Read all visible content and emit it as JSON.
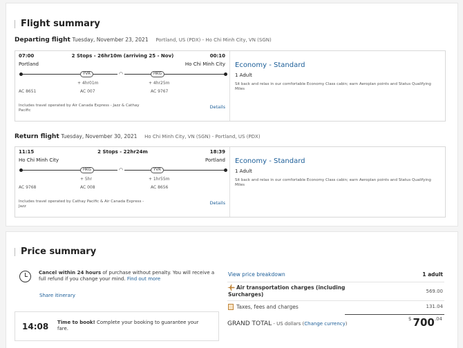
{
  "flight_summary": {
    "title": "Flight summary",
    "departing": {
      "label": "Departing flight",
      "date": "Tuesday, November 23, 2021",
      "route": "Portland, US (PDX) - Ho Chi Minh City, VN (SGN)",
      "dep_time": "07:00",
      "stops": "2 Stops - 26hr10m (arriving 25 - Nov)",
      "arr_time": "00:10",
      "origin": "Portland",
      "destination": "Ho Chi Minh City",
      "stop1": "YVR",
      "stop2": "HKG",
      "layover1": "+ 4hr01m",
      "layover2": "+ 4hr25m",
      "flight1": "AC 8651",
      "flight2": "AC 007",
      "flight3": "AC 9767",
      "operated_by": "Includes travel operated by Air Canada Express - Jazz & Cathay Pacific",
      "details": "Details",
      "cabin": "Economy - Standard",
      "passengers": "1 Adult",
      "cabin_desc": "Sit back and relax in our comfortable Economy Class cabin; earn Aeroplan points and Status Qualifying Miles"
    },
    "return": {
      "label": "Return flight",
      "date": "Tuesday, November 30, 2021",
      "route": "Ho Chi Minh City, VN (SGN) - Portland, US (PDX)",
      "dep_time": "11:15",
      "stops": "2 Stops - 22hr24m",
      "arr_time": "18:39",
      "origin": "Ho Chi Minh City",
      "destination": "Portland",
      "stop1": "HKG",
      "stop2": "YVR",
      "layover1": "+ 5hr",
      "layover2": "+ 1hr55m",
      "flight1": "AC 9768",
      "flight2": "AC 008",
      "flight3": "AC 8656",
      "operated_by": "Includes travel operated by Cathay Pacific & Air Canada Express - Jazz",
      "details": "Details",
      "cabin": "Economy - Standard",
      "passengers": "1 Adult",
      "cabin_desc": "Sit back and relax in our comfortable Economy Class cabin; earn Aeroplan points and Status Qualifying Miles"
    }
  },
  "price_summary": {
    "title": "Price summary",
    "cancel_bold": "Cancel within 24 hours",
    "cancel_text": " of purchase without penalty. You will receive a full refund if you change your mind.",
    "find_out_more": "Find out more",
    "share": "Share itinerary",
    "timer": "14:08",
    "time_bold": "Time to book!",
    "time_text": " Complete your booking to guarantee your fare.",
    "breakdown_link": "View price breakdown",
    "adult_col": "1 adult",
    "air_label": "Air transportation charges (including Surcharges)",
    "air_value": "569.00",
    "tax_label": "Taxes, fees and charges",
    "tax_value": "131.04",
    "grand_label": "GRAND TOTAL",
    "grand_currency": " - US dollars (",
    "change_currency": "Change currency",
    "grand_close": ")",
    "grand_symbol": "$",
    "grand_int": "700",
    "grand_dec": ".04"
  },
  "colors": {
    "link": "#1c5e98",
    "accent_icon": "#c0853a"
  }
}
